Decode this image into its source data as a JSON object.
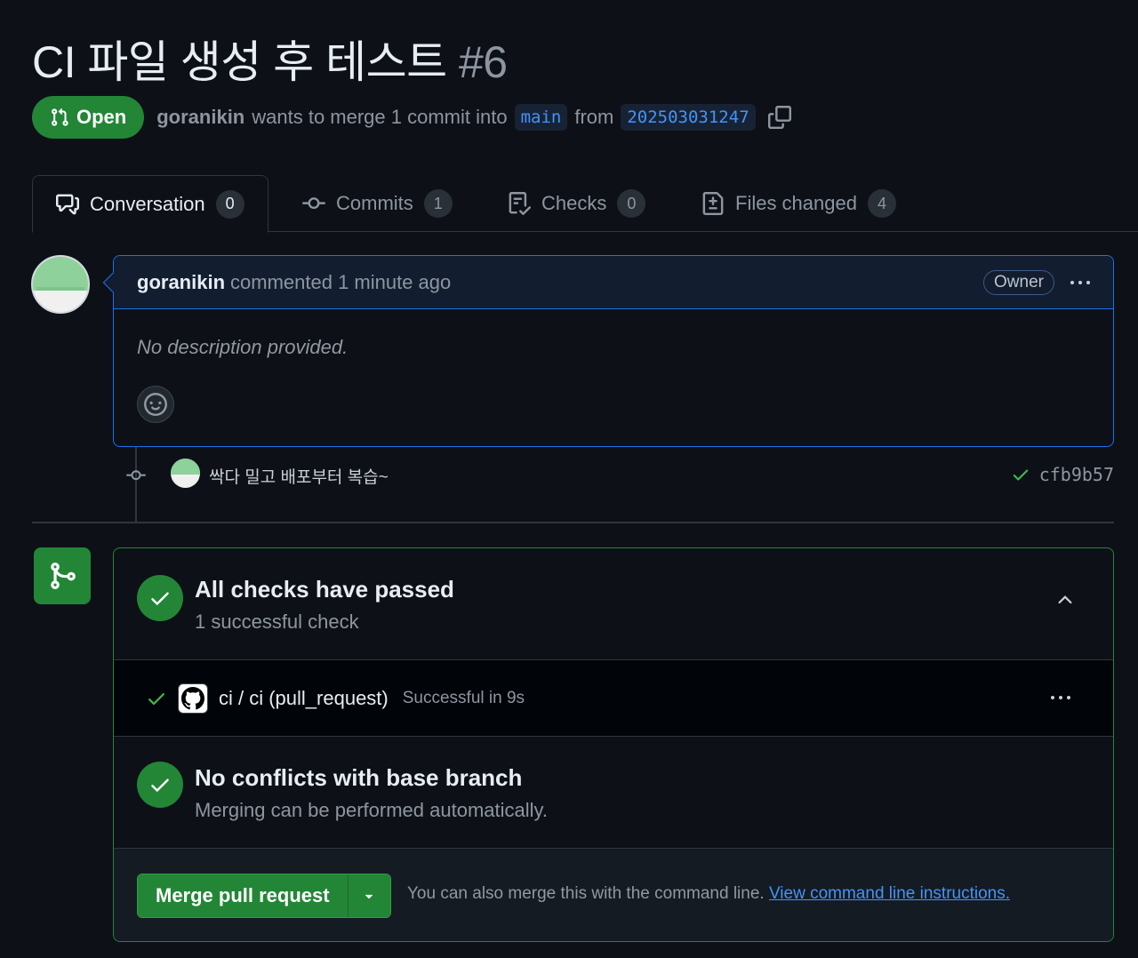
{
  "pr": {
    "title": "CI 파일 생성 후 테스트",
    "number": "#6",
    "state": "Open",
    "author": "goranikin",
    "merge_text": "wants to merge 1 commit into",
    "base_branch": "main",
    "from_text": "from",
    "head_branch": "202503031247"
  },
  "tabs": [
    {
      "label": "Conversation",
      "count": "0"
    },
    {
      "label": "Commits",
      "count": "1"
    },
    {
      "label": "Checks",
      "count": "0"
    },
    {
      "label": "Files changed",
      "count": "4"
    }
  ],
  "comment": {
    "author": "goranikin",
    "meta": "commented 1 minute ago",
    "role_badge": "Owner",
    "body": "No description provided."
  },
  "commit": {
    "message": "싹다 밀고 배포부터 복습~",
    "sha": "cfb9b57"
  },
  "checks": {
    "title": "All checks have passed",
    "subtitle": "1 successful check",
    "ci_name": "ci / ci (pull_request)",
    "ci_status": "Successful in 9s"
  },
  "conflicts": {
    "title": "No conflicts with base branch",
    "subtitle": "Merging can be performed automatically."
  },
  "merge": {
    "button_label": "Merge pull request",
    "hint": "You can also merge this with the command line.",
    "link": "View command line instructions."
  },
  "colors": {
    "background": "#0d1117",
    "success": "#238636",
    "accent_link": "#4493f8",
    "comment_border": "#1f6feb"
  }
}
